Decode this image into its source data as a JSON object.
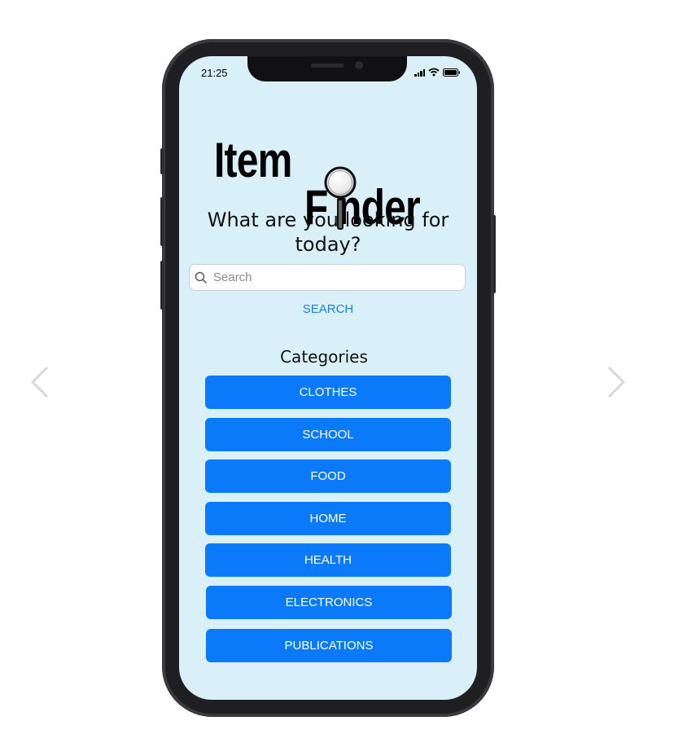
{
  "status_bar": {
    "time": "21:25"
  },
  "logo": {
    "line1": "Item",
    "line2": "F nder"
  },
  "headline": "What are you looking for today?",
  "search": {
    "placeholder": "Search",
    "button_label": "SEARCH"
  },
  "categories": {
    "title": "Categories",
    "items": [
      {
        "label": "CLOTHES"
      },
      {
        "label": "SCHOOL"
      },
      {
        "label": "FOOD"
      },
      {
        "label": "HOME"
      },
      {
        "label": "HEALTH"
      },
      {
        "label": "ELECTRONICS"
      },
      {
        "label": "PUBLICATIONS"
      }
    ]
  },
  "colors": {
    "screen_bg": "#daf0f8",
    "button_bg": "#0a7afb",
    "link": "#1a7ee6"
  }
}
